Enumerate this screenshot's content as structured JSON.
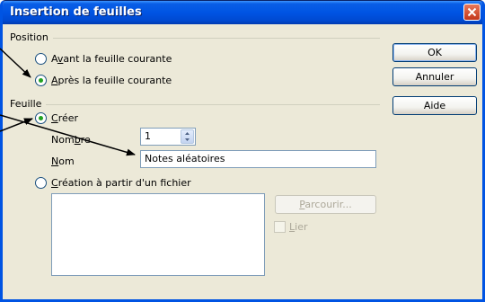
{
  "window": {
    "title": "Insertion de feuilles"
  },
  "position": {
    "legend": "Position",
    "before": {
      "pre": "A",
      "key": "v",
      "post": "ant la feuille courante"
    },
    "after": {
      "key": "A",
      "post": "près la feuille courante"
    },
    "selected": "after"
  },
  "feuille": {
    "legend": "Feuille",
    "create": {
      "key": "C",
      "post": "réer",
      "selected": true
    },
    "count_label": {
      "pre": "Nom",
      "key": "b",
      "post": "re"
    },
    "count_value": "1",
    "name_label": {
      "key": "N",
      "post": "om"
    },
    "name_value": "Notes aléatoires",
    "from_file": {
      "key": "C",
      "post": "réation à partir d'un fichier",
      "selected": false
    },
    "browse_button": {
      "key": "P",
      "post": "arcourir..."
    },
    "link_checkbox": {
      "key": "L",
      "post": "ier",
      "checked": false
    }
  },
  "buttons": {
    "ok": "OK",
    "cancel": "Annuler",
    "help": "Aide"
  },
  "colors": {
    "title_bar": "#0054e3",
    "dialog_bg": "#ece9d8",
    "selected_radio_dot": "#21a121",
    "close_button": "#d94f2b"
  },
  "icons": {
    "close": "close-icon",
    "spin_up": "spin-up-icon",
    "spin_down": "spin-down-icon"
  }
}
